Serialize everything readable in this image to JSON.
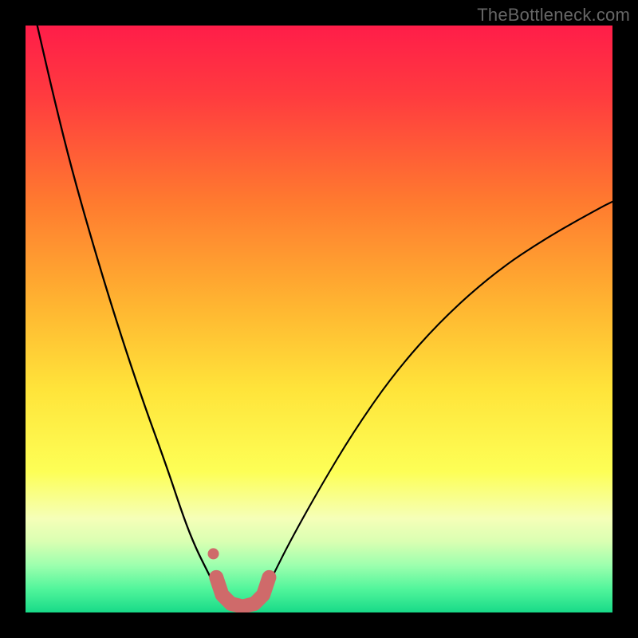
{
  "watermark": "TheBottleneck.com",
  "chart_data": {
    "type": "line",
    "title": "",
    "xlabel": "",
    "ylabel": "",
    "xlim": [
      0,
      100
    ],
    "ylim": [
      0,
      100
    ],
    "series": [
      {
        "name": "left-branch",
        "x": [
          2,
          5,
          8,
          12,
          16,
          20,
          24,
          27,
          29,
          31,
          32.5,
          33.5
        ],
        "y": [
          100,
          87,
          75,
          61,
          48,
          36,
          25,
          16,
          11,
          7,
          4,
          2
        ]
      },
      {
        "name": "right-branch",
        "x": [
          40,
          42,
          45,
          50,
          56,
          63,
          71,
          80,
          89,
          98,
          100
        ],
        "y": [
          2,
          6,
          12,
          21,
          31,
          41,
          50,
          58,
          64,
          69,
          70
        ]
      },
      {
        "name": "valley-highlight",
        "x": [
          32.5,
          33.5,
          35,
          37,
          39,
          40.5,
          41.5
        ],
        "y": [
          6,
          3,
          1.5,
          1,
          1.5,
          3,
          6
        ]
      },
      {
        "name": "valley-dot",
        "x": [
          32
        ],
        "y": [
          10
        ]
      }
    ],
    "gradient_stops": [
      {
        "offset": 0,
        "color": "#ff1d49"
      },
      {
        "offset": 12,
        "color": "#ff3b3f"
      },
      {
        "offset": 30,
        "color": "#ff7a2f"
      },
      {
        "offset": 48,
        "color": "#ffb631"
      },
      {
        "offset": 62,
        "color": "#ffe43a"
      },
      {
        "offset": 76,
        "color": "#fdff56"
      },
      {
        "offset": 84,
        "color": "#f5ffb8"
      },
      {
        "offset": 88,
        "color": "#d9ffb2"
      },
      {
        "offset": 92,
        "color": "#9cffae"
      },
      {
        "offset": 96,
        "color": "#51f59b"
      },
      {
        "offset": 100,
        "color": "#18da88"
      }
    ]
  }
}
